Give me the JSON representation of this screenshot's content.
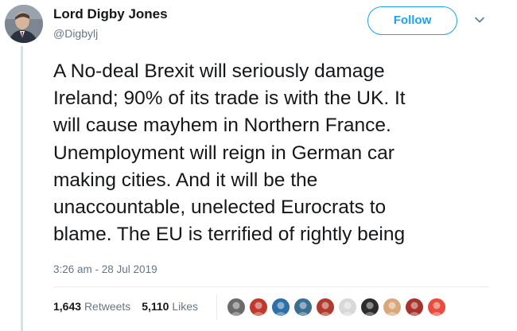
{
  "tweet": {
    "author": {
      "display_name": "Lord Digby Jones",
      "handle": "@Digbylj",
      "avatar_icon": "profile-photo"
    },
    "follow_label": "Follow",
    "more_icon": "chevron-down-icon",
    "text_lines": [
      "A No-deal Brexit will seriously damage",
      "Ireland; 90% of its trade is with the UK. It",
      "will cause mayhem in Northern France.",
      "Unemployment will reign in German car",
      "making cities. And it will be the",
      "unaccountable, unelected Eurocrats to",
      "blame. The EU is terrified of rightly being"
    ],
    "timestamp": "3:26 am - 28 Jul 2019",
    "retweets": {
      "count": "1,643",
      "label": "Retweets"
    },
    "likes": {
      "count": "5,110",
      "label": "Likes"
    },
    "liker_avatars": [
      {
        "name": "liker-avatar-1",
        "color": "#6b6b6b"
      },
      {
        "name": "liker-avatar-2",
        "color": "#c0392b"
      },
      {
        "name": "liker-avatar-3",
        "color": "#2f6fa8"
      },
      {
        "name": "liker-avatar-4",
        "color": "#3b6e8f"
      },
      {
        "name": "liker-avatar-5",
        "color": "#b03a2e"
      },
      {
        "name": "liker-avatar-6",
        "color": "#d8d8d8"
      },
      {
        "name": "liker-avatar-7",
        "color": "#2c2c2c"
      },
      {
        "name": "liker-avatar-8",
        "color": "#d9a87a"
      },
      {
        "name": "liker-avatar-9",
        "color": "#a5322b"
      },
      {
        "name": "liker-avatar-10",
        "color": "#e94b3c"
      }
    ]
  },
  "colors": {
    "accent": "#1da1f2",
    "text": "#14171a",
    "muted": "#657786",
    "divider": "#e6ecf0"
  }
}
